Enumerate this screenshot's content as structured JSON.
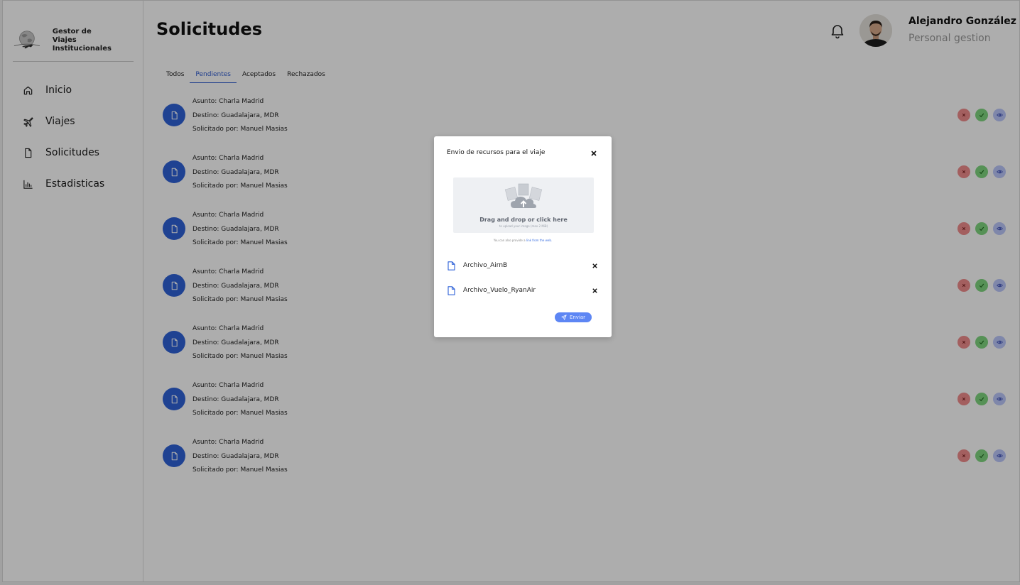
{
  "brand": {
    "line1": "Gestor de",
    "line2": "Viajes Institucionales"
  },
  "sidebar": {
    "items": [
      {
        "label": "Inicio",
        "icon": "home-icon"
      },
      {
        "label": "Viajes",
        "icon": "plane-icon"
      },
      {
        "label": "Solicitudes",
        "icon": "document-icon"
      },
      {
        "label": "Estadisticas",
        "icon": "bar-chart-icon"
      }
    ]
  },
  "header": {
    "title": "Solicitudes",
    "user_name": "Alejandro González",
    "user_role": "Personal gestion"
  },
  "tabs": [
    {
      "label": "Todos",
      "active": false
    },
    {
      "label": "Pendientes",
      "active": true
    },
    {
      "label": "Aceptados",
      "active": false
    },
    {
      "label": "Rechazados",
      "active": false
    }
  ],
  "requests": [
    {
      "subject": "Asunto: Charla Madrid",
      "destination": "Destino: Guadalajara, MDR",
      "requested_by": "Solicitado por:  Manuel Masias"
    },
    {
      "subject": "Asunto: Charla Madrid",
      "destination": "Destino: Guadalajara, MDR",
      "requested_by": "Solicitado por:  Manuel Masias"
    },
    {
      "subject": "Asunto: Charla Madrid",
      "destination": "Destino: Guadalajara, MDR",
      "requested_by": "Solicitado por:  Manuel Masias"
    },
    {
      "subject": "Asunto: Charla Madrid",
      "destination": "Destino: Guadalajara, MDR",
      "requested_by": "Solicitado por:  Manuel Masias"
    },
    {
      "subject": "Asunto: Charla Madrid",
      "destination": "Destino: Guadalajara, MDR",
      "requested_by": "Solicitado por:  Manuel Masias"
    },
    {
      "subject": "Asunto: Charla Madrid",
      "destination": "Destino: Guadalajara, MDR",
      "requested_by": "Solicitado por:  Manuel Masias"
    },
    {
      "subject": "Asunto: Charla Madrid",
      "destination": "Destino: Guadalajara, MDR",
      "requested_by": "Solicitado por:  Manuel Masias"
    }
  ],
  "modal": {
    "title": "Envio de recursos para el viaje",
    "dropzone_main": "Drag and drop or click here",
    "dropzone_sub": "to upload your image (max 2 MiB)",
    "dropzone_note_prefix": "You can also provide a ",
    "dropzone_note_link": "link from the web.",
    "files": [
      {
        "name": "Archivo_AirnB"
      },
      {
        "name": "Archivo_Vuelo_RyanAir"
      }
    ],
    "send_label": "Enviar"
  },
  "colors": {
    "primary": "#2f62d8",
    "reject": "#f08d8d",
    "accept": "#7fd67f",
    "view": "#bcc7fb",
    "send_button": "#5d86f4"
  }
}
